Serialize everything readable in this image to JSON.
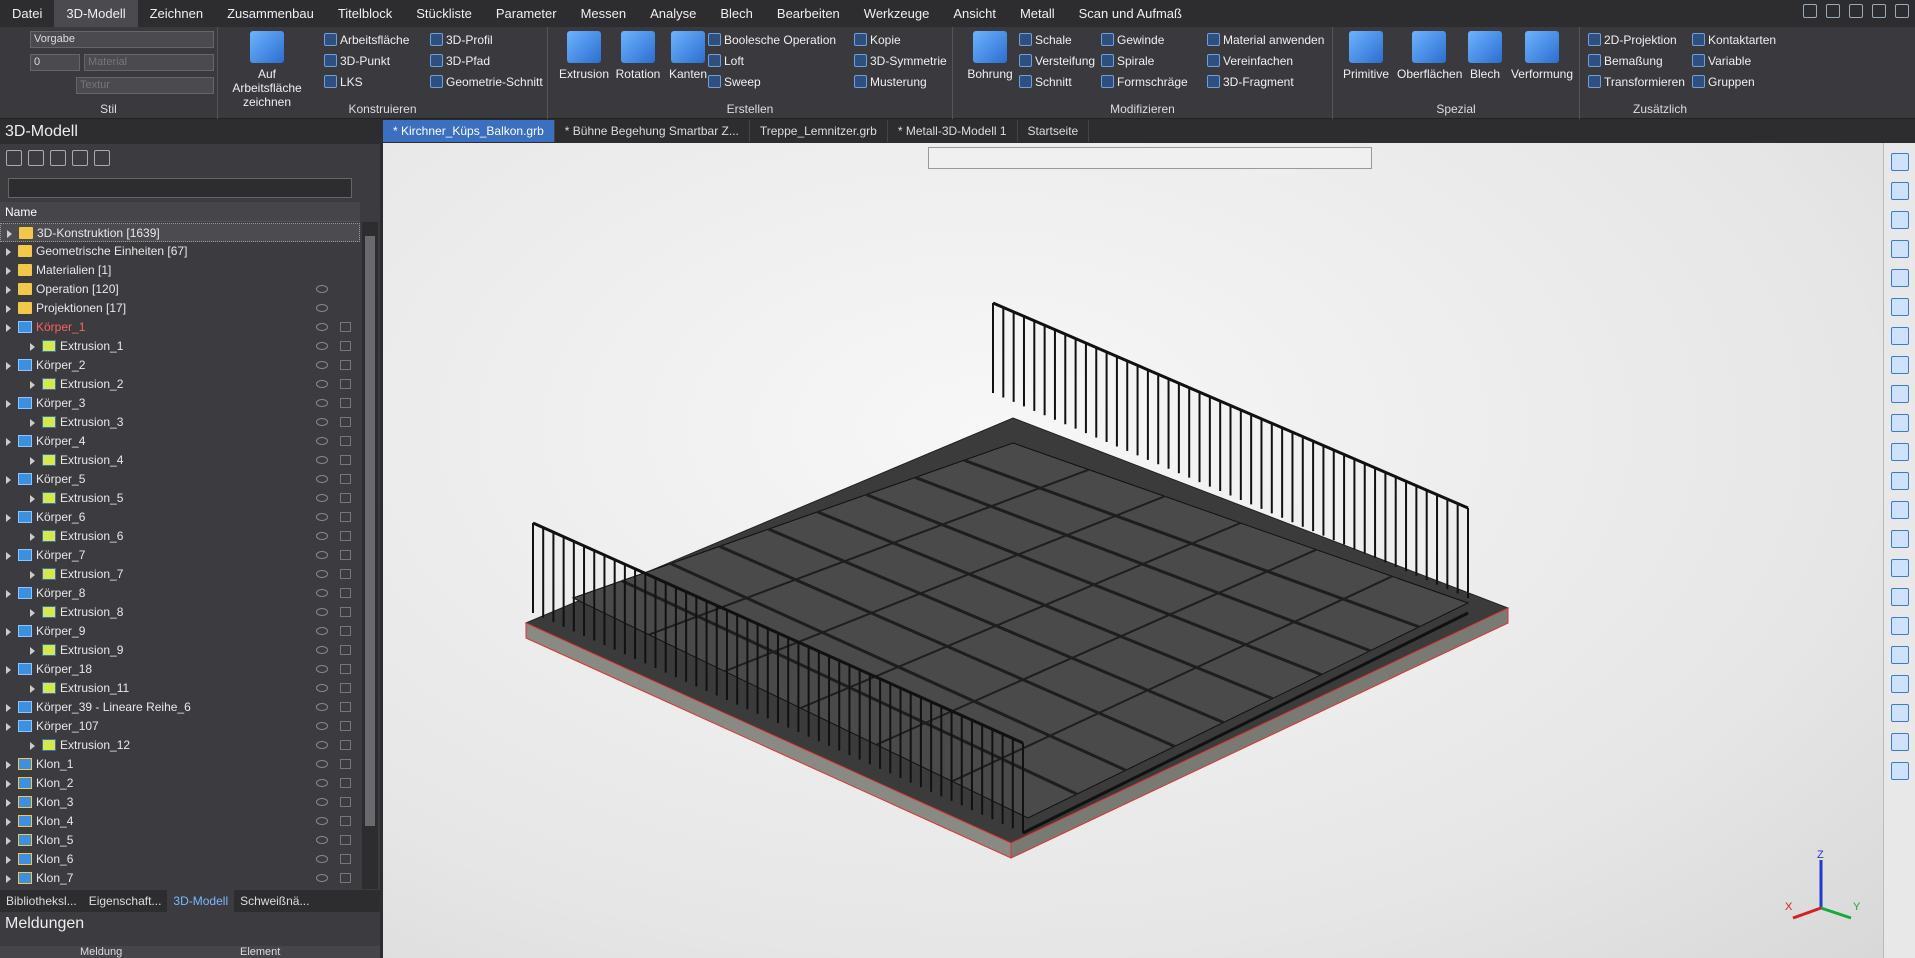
{
  "menu": {
    "items": [
      "Datei",
      "3D-Modell",
      "Zeichnen",
      "Zusammenbau",
      "Titelblock",
      "Stückliste",
      "Parameter",
      "Messen",
      "Analyse",
      "Blech",
      "Bearbeiten",
      "Werkzeuge",
      "Ansicht",
      "Metall",
      "Scan und Aufmaß"
    ],
    "active": "3D-Modell"
  },
  "ribbon": {
    "stil": {
      "label": "Stil",
      "style_value": "Vorgabe",
      "layer_value": "0",
      "material_placeholder": "Material",
      "texture_placeholder": "Textur"
    },
    "konstruieren": {
      "label": "Konstruieren",
      "big": "Auf Arbeitsfläche zeichnen",
      "items": [
        "Arbeitsfläche",
        "3D-Punkt",
        "LKS",
        "3D-Profil",
        "3D-Pfad",
        "Geometrie-Schnitt"
      ]
    },
    "erstellen": {
      "label": "Erstellen",
      "big": [
        "Extrusion",
        "Rotation",
        "Kanten"
      ],
      "items": [
        "Boolesche Operation",
        "Loft",
        "Sweep",
        "Kopie",
        "3D-Symmetrie",
        "Musterung"
      ]
    },
    "modifizieren": {
      "label": "Modifizieren",
      "big": "Bohrung",
      "items": [
        "Schale",
        "Versteifung",
        "Schnitt",
        "Gewinde",
        "Spirale",
        "Formschräge",
        "Material anwenden",
        "Vereinfachen",
        "3D-Fragment"
      ]
    },
    "spezial": {
      "label": "Spezial",
      "big": [
        "Primitive",
        "Oberflächen",
        "Blech",
        "Verformung"
      ]
    },
    "zusaetzlich": {
      "label": "Zusätzlich",
      "items": [
        "2D-Projektion",
        "Bemaßung",
        "Transformieren",
        "Kontaktarten",
        "Variable",
        "Gruppen"
      ]
    }
  },
  "left_panel": {
    "title": "3D-Modell",
    "column_name": "Name",
    "tree": [
      {
        "label": "3D-Konstruktion [1639]",
        "icon": "folder",
        "indent": 0,
        "selected": true
      },
      {
        "label": "Geometrische Einheiten [67]",
        "icon": "folder",
        "indent": 0
      },
      {
        "label": "Materialien [1]",
        "icon": "folder",
        "indent": 0
      },
      {
        "label": "Operation [120]",
        "icon": "folder",
        "indent": 0
      },
      {
        "label": "Projektionen [17]",
        "icon": "folder",
        "indent": 0
      },
      {
        "label": "Körper_1",
        "icon": "body",
        "indent": 0,
        "red": true
      },
      {
        "label": "Extrusion_1",
        "icon": "ext",
        "indent": 1
      },
      {
        "label": "Körper_2",
        "icon": "body",
        "indent": 0
      },
      {
        "label": "Extrusion_2",
        "icon": "ext",
        "indent": 1
      },
      {
        "label": "Körper_3",
        "icon": "body",
        "indent": 0
      },
      {
        "label": "Extrusion_3",
        "icon": "ext",
        "indent": 1
      },
      {
        "label": "Körper_4",
        "icon": "body",
        "indent": 0
      },
      {
        "label": "Extrusion_4",
        "icon": "ext",
        "indent": 1
      },
      {
        "label": "Körper_5",
        "icon": "body",
        "indent": 0
      },
      {
        "label": "Extrusion_5",
        "icon": "ext",
        "indent": 1
      },
      {
        "label": "Körper_6",
        "icon": "body",
        "indent": 0
      },
      {
        "label": "Extrusion_6",
        "icon": "ext",
        "indent": 1
      },
      {
        "label": "Körper_7",
        "icon": "body",
        "indent": 0
      },
      {
        "label": "Extrusion_7",
        "icon": "ext",
        "indent": 1
      },
      {
        "label": "Körper_8",
        "icon": "body",
        "indent": 0
      },
      {
        "label": "Extrusion_8",
        "icon": "ext",
        "indent": 1
      },
      {
        "label": "Körper_9",
        "icon": "body",
        "indent": 0
      },
      {
        "label": "Extrusion_9",
        "icon": "ext",
        "indent": 1
      },
      {
        "label": "Körper_18",
        "icon": "body",
        "indent": 0
      },
      {
        "label": "Extrusion_11",
        "icon": "ext",
        "indent": 1
      },
      {
        "label": "Körper_39 - Lineare Reihe_6",
        "icon": "body",
        "indent": 0
      },
      {
        "label": "Körper_107",
        "icon": "body",
        "indent": 0
      },
      {
        "label": "Extrusion_12",
        "icon": "ext",
        "indent": 1
      },
      {
        "label": "Klon_1",
        "icon": "clone",
        "indent": 0
      },
      {
        "label": "Klon_2",
        "icon": "clone",
        "indent": 0
      },
      {
        "label": "Klon_3",
        "icon": "clone",
        "indent": 0
      },
      {
        "label": "Klon_4",
        "icon": "clone",
        "indent": 0
      },
      {
        "label": "Klon_5",
        "icon": "clone",
        "indent": 0
      },
      {
        "label": "Klon_6",
        "icon": "clone",
        "indent": 0
      },
      {
        "label": "Klon_7",
        "icon": "clone",
        "indent": 0
      }
    ],
    "bottom_tabs": [
      "Bibliotheksl...",
      "Eigenschaft...",
      "3D-Modell",
      "Schweißnä..."
    ],
    "active_bottom_tab": "3D-Modell"
  },
  "messages": {
    "title": "Meldungen",
    "columns": [
      "Meldung",
      "Element"
    ]
  },
  "doc_tabs": [
    "* Kirchner_Küps_Balkon.grb",
    "* Bühne Begehung Smartbar Z...",
    "Treppe_Lemnitzer.grb",
    "* Metall-3D-Modell 1",
    "Startseite"
  ],
  "active_doc_tab": "* Kirchner_Küps_Balkon.grb",
  "axes": {
    "x": "X",
    "y": "Y",
    "z": "Z"
  }
}
